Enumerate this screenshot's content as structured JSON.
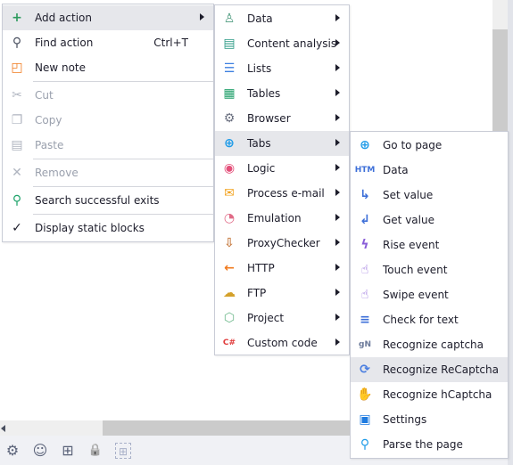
{
  "colors": {
    "highlight": "#e6e7eb",
    "border": "#c9ccd6",
    "disabled": "#9aa0ad",
    "toolbar_bg": "#f0f1f5"
  },
  "menu1": {
    "items": [
      {
        "label": "Add action",
        "icon": "plus-icon",
        "color": "#2e9b5e",
        "glyph": "+",
        "submenu": true,
        "highlighted": true
      },
      {
        "label": "Find action",
        "icon": "search-icon",
        "color": "#4a5060",
        "glyph": "⚲",
        "shortcut": "Ctrl+T"
      },
      {
        "label": "New note",
        "icon": "note-icon",
        "color": "#f07a1e",
        "glyph": "◰",
        "sep_after": true
      },
      {
        "label": "Cut",
        "icon": "scissors-icon",
        "color": "#b0b5c0",
        "glyph": "✂",
        "disabled": true
      },
      {
        "label": "Copy",
        "icon": "copy-icon",
        "color": "#b0b5c0",
        "glyph": "❐",
        "disabled": true
      },
      {
        "label": "Paste",
        "icon": "paste-icon",
        "color": "#b0b5c0",
        "glyph": "▤",
        "disabled": true,
        "sep_after": true
      },
      {
        "label": "Remove",
        "icon": "close-icon",
        "color": "#b0b5c0",
        "glyph": "✕",
        "disabled": true,
        "sep_after": true
      },
      {
        "label": "Search successful exits",
        "icon": "search-check-icon",
        "color": "#1fa36b",
        "glyph": "⚲",
        "sep_after": true
      },
      {
        "label": "Display static blocks",
        "icon": "check-icon",
        "color": "#1d1d2b",
        "glyph": "✓"
      }
    ]
  },
  "menu2": {
    "items": [
      {
        "label": "Data",
        "icon": "user-icon",
        "color": "#4c9a7e",
        "glyph": "♙"
      },
      {
        "label": "Content analysis",
        "icon": "document-icon",
        "color": "#2e9b86",
        "glyph": "▤"
      },
      {
        "label": "Lists",
        "icon": "list-icon",
        "color": "#3d7fe0",
        "glyph": "☰"
      },
      {
        "label": "Tables",
        "icon": "table-icon",
        "color": "#22a06b",
        "glyph": "▦"
      },
      {
        "label": "Browser",
        "icon": "gear-icon",
        "color": "#6b7080",
        "glyph": "⚙"
      },
      {
        "label": "Tabs",
        "icon": "globe-icon",
        "color": "#1e9be8",
        "glyph": "⊕",
        "highlighted": true
      },
      {
        "label": "Logic",
        "icon": "toggle-icon",
        "color": "#e4507a",
        "glyph": "◉"
      },
      {
        "label": "Process e-mail",
        "icon": "mail-icon",
        "color": "#f2a11b",
        "glyph": "✉"
      },
      {
        "label": "Emulation",
        "icon": "mouse-icon",
        "color": "#e06a86",
        "glyph": "◔"
      },
      {
        "label": "ProxyChecker",
        "icon": "download-box-icon",
        "color": "#c9814a",
        "glyph": "⇩"
      },
      {
        "label": "HTTP",
        "icon": "http-get-icon",
        "color": "#f07a1e",
        "glyph": "←"
      },
      {
        "label": "FTP",
        "icon": "ftp-icon",
        "color": "#d4a12a",
        "glyph": "☁"
      },
      {
        "label": "Project",
        "icon": "cube-icon",
        "color": "#6cb88a",
        "glyph": "⬡"
      },
      {
        "label": "Custom code",
        "icon": "csharp-icon",
        "color": "#e03a3a",
        "glyph": "C#"
      }
    ]
  },
  "menu3": {
    "items": [
      {
        "label": "Go to page",
        "icon": "globe-icon",
        "color": "#1e9be8",
        "glyph": "⊕"
      },
      {
        "label": "Data",
        "icon": "html-icon",
        "color": "#3d6fd8",
        "glyph": "HTM"
      },
      {
        "label": "Set value",
        "icon": "arrow-set-icon",
        "color": "#3d6fd8",
        "glyph": "↳"
      },
      {
        "label": "Get value",
        "icon": "arrow-get-icon",
        "color": "#3d6fd8",
        "glyph": "↲"
      },
      {
        "label": "Rise event",
        "icon": "lightning-icon",
        "color": "#8a5ed8",
        "glyph": "ϟ"
      },
      {
        "label": "Touch event",
        "icon": "touch-icon",
        "color": "#8a5ed8",
        "glyph": "☝"
      },
      {
        "label": "Swipe event",
        "icon": "swipe-icon",
        "color": "#8a5ed8",
        "glyph": "☝"
      },
      {
        "label": "Check for text",
        "icon": "text-check-icon",
        "color": "#3d6fd8",
        "glyph": "≡"
      },
      {
        "label": "Recognize captcha",
        "icon": "captcha-icon",
        "color": "#6b7a9a",
        "glyph": "gN"
      },
      {
        "label": "Recognize ReCaptcha",
        "icon": "refresh-icon",
        "color": "#4a7ee0",
        "glyph": "⟳",
        "highlighted": true
      },
      {
        "label": "Recognize hCaptcha",
        "icon": "hand-icon",
        "color": "#2ab0c8",
        "glyph": "✋"
      },
      {
        "label": "Settings",
        "icon": "window-settings-icon",
        "color": "#1e7be0",
        "glyph": "▣"
      },
      {
        "label": "Parse the page",
        "icon": "search-icon",
        "color": "#1e9be8",
        "glyph": "⚲"
      }
    ]
  },
  "toolbar": [
    {
      "icon": "gear-icon",
      "glyph": "⚙"
    },
    {
      "icon": "user-circle-icon",
      "glyph": "☺"
    },
    {
      "icon": "grid-icon",
      "glyph": "⊞"
    },
    {
      "icon": "lock-icon",
      "glyph": "🔒"
    },
    {
      "icon": "add-block-icon",
      "glyph": "⊞",
      "disabled": true
    }
  ]
}
